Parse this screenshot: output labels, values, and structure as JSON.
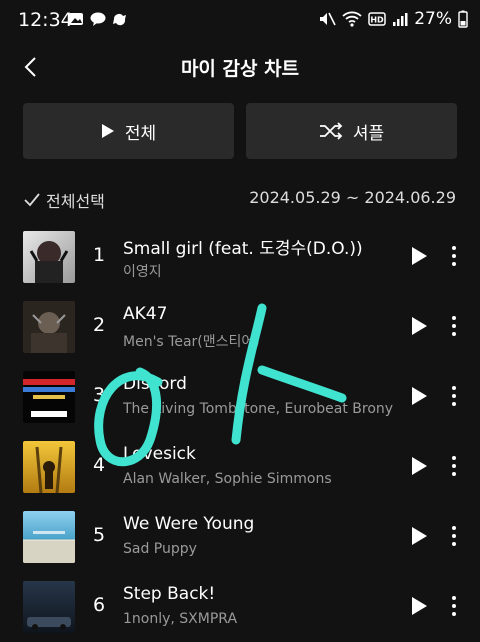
{
  "status": {
    "time": "12:34",
    "battery": "27%"
  },
  "header": {
    "title": "마이 감상 차트"
  },
  "buttons": {
    "play_all": "전체",
    "shuffle": "셔플"
  },
  "selection": {
    "select_all": "전체선택",
    "date_range": "2024.05.29 ~ 2024.06.29"
  },
  "tracks": [
    {
      "rank": "1",
      "title": "Small girl (feat. 도경수(D.O.))",
      "artist": "이영지"
    },
    {
      "rank": "2",
      "title": "AK47",
      "artist": "Men's Tear(맨스티어)"
    },
    {
      "rank": "3",
      "title": "Discord",
      "artist": "The Living Tombstone, Eurobeat Brony"
    },
    {
      "rank": "4",
      "title": "Lovesick",
      "artist": "Alan Walker, Sophie Simmons"
    },
    {
      "rank": "5",
      "title": "We Were Young",
      "artist": "Sad Puppy"
    },
    {
      "rank": "6",
      "title": "Step Back!",
      "artist": "1nonly, SXMPRA"
    }
  ],
  "colors": {
    "background": "#121212",
    "button_bg": "#2a2a2a",
    "scribble": "#3fe3cf"
  }
}
